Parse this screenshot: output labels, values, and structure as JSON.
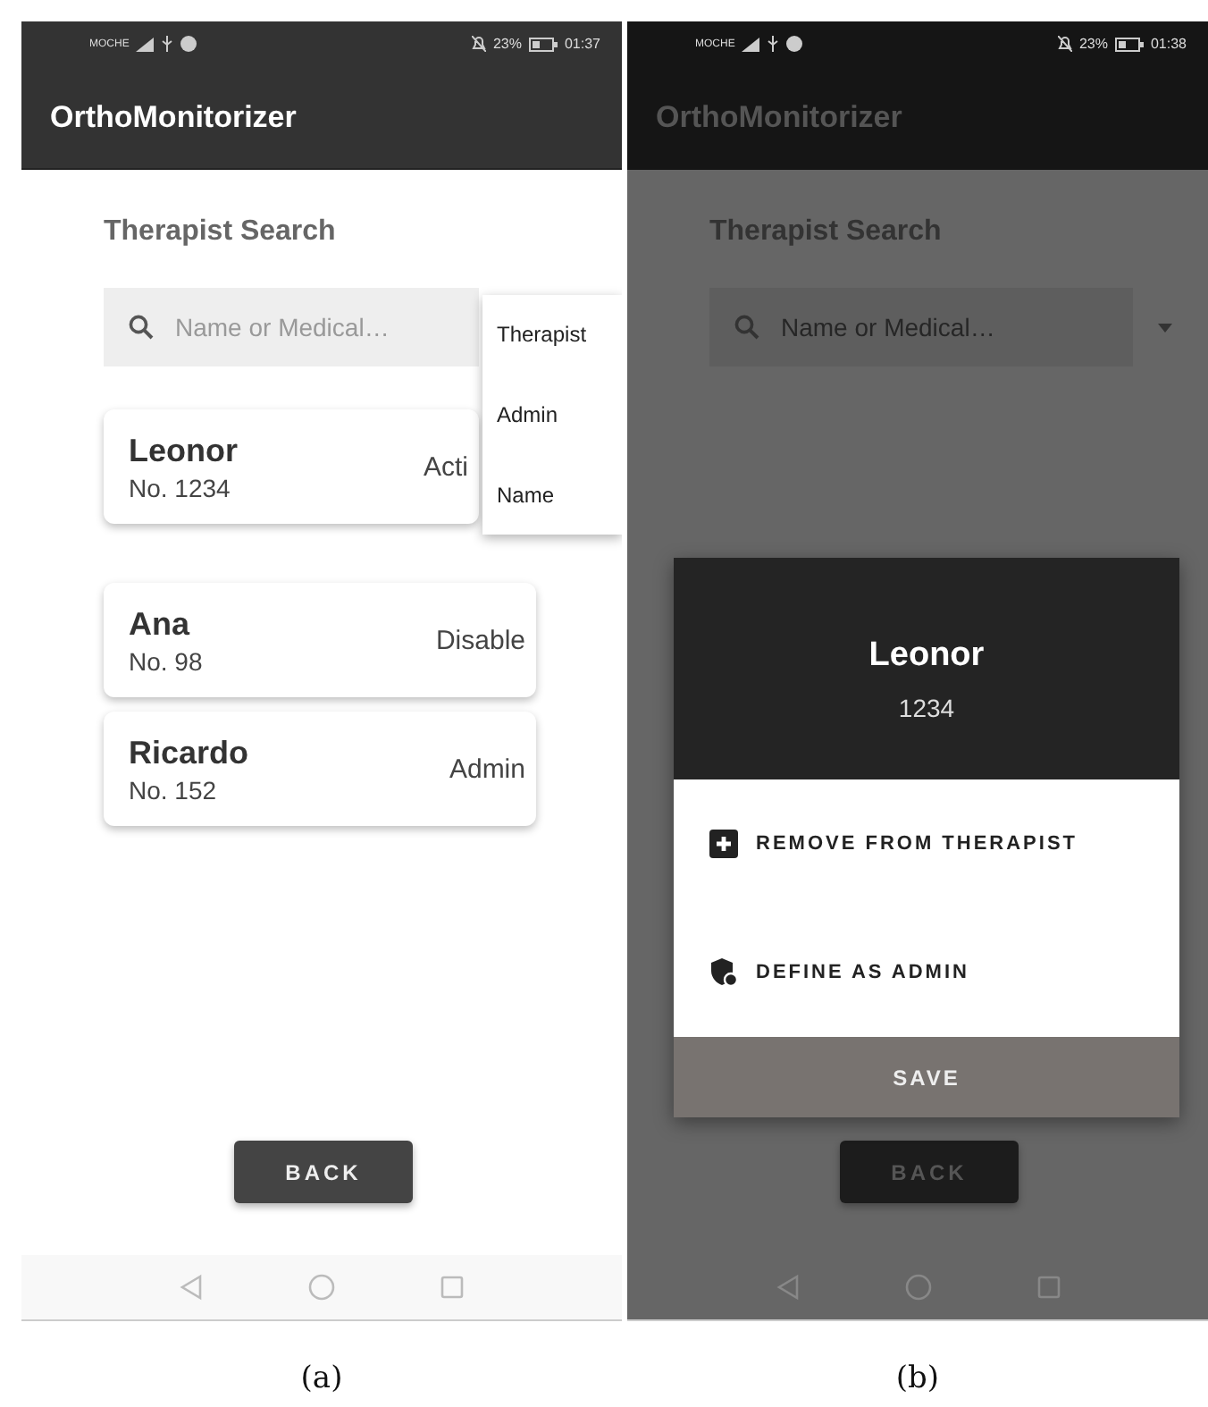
{
  "screens": [
    {
      "caption": "(a)",
      "dimmed": false,
      "status_bar": {
        "carrier": "MOCHE",
        "battery": "23%",
        "time": "01:37"
      },
      "app_title": "OrthoMonitorizer",
      "heading": "Therapist Search",
      "search": {
        "placeholder": "Name or Medical…"
      },
      "filter_menu": {
        "items": [
          "Therapist",
          "Admin",
          "Name"
        ]
      },
      "users": [
        {
          "name": "Leonor",
          "number": "No. 1234",
          "status": "Acti"
        },
        {
          "name": "Ana",
          "number": "No. 98",
          "status": "Disable"
        },
        {
          "name": "Ricardo",
          "number": "No. 152",
          "status": "Admin"
        }
      ],
      "back_button": "BACK"
    },
    {
      "caption": "(b)",
      "dimmed": true,
      "status_bar": {
        "carrier": "MOCHE",
        "battery": "23%",
        "time": "01:38"
      },
      "app_title": "OrthoMonitorizer",
      "heading": "Therapist Search",
      "search": {
        "placeholder": "Name or Medical…"
      },
      "dialog": {
        "name": "Leonor",
        "number": "1234",
        "actions": [
          {
            "kind": "remove",
            "label": "REMOVE FROM THERAPIST"
          },
          {
            "kind": "admin",
            "label": "DEFINE AS ADMIN"
          }
        ],
        "save": "SAVE"
      },
      "back_button": "BACK"
    }
  ]
}
